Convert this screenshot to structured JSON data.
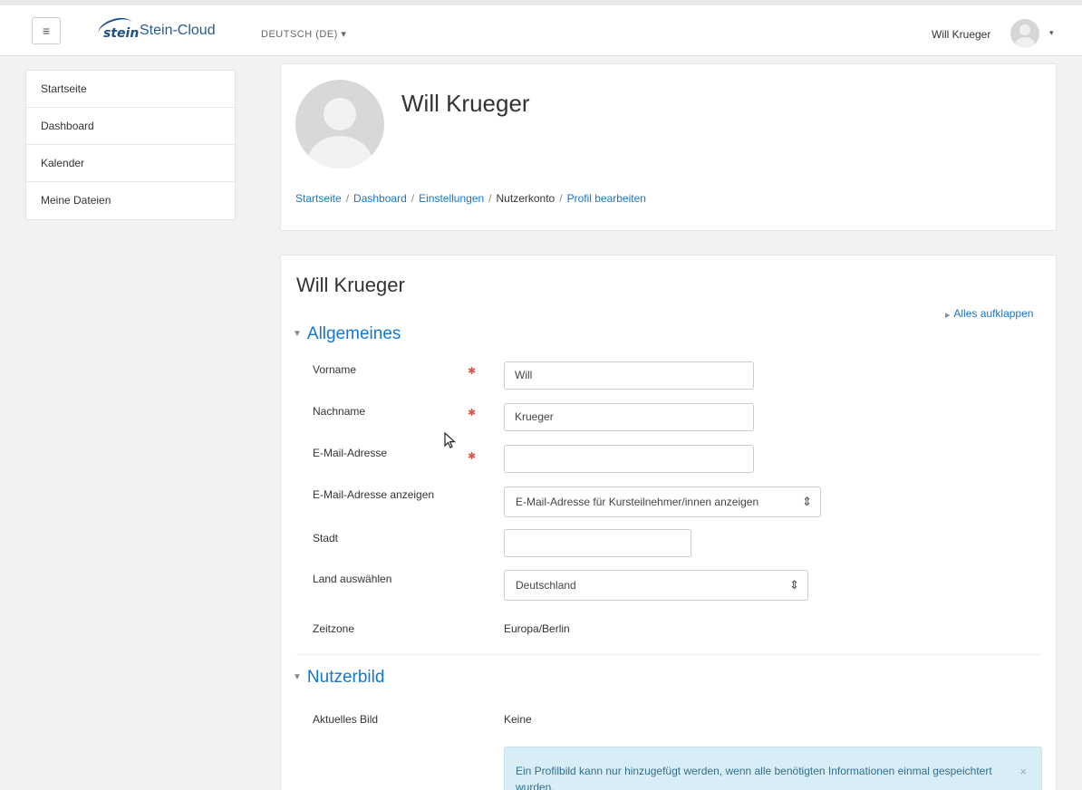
{
  "navbar": {
    "menu_icon": "hamburger-icon",
    "logo_word": "stein",
    "site_title": "Stein-Cloud",
    "language": "DEUTSCH (DE) ▾",
    "user_name": "Will Krueger",
    "user_caret": "▾"
  },
  "sidebar": {
    "items": [
      {
        "label": "Startseite"
      },
      {
        "label": "Dashboard"
      },
      {
        "label": "Kalender"
      },
      {
        "label": "Meine Dateien"
      }
    ]
  },
  "header": {
    "name": "Will Krueger",
    "breadcrumb": [
      {
        "label": "Startseite",
        "link": true
      },
      {
        "label": "Dashboard",
        "link": true
      },
      {
        "label": "Einstellungen",
        "link": true
      },
      {
        "label": "Nutzerkonto",
        "link": false
      },
      {
        "label": "Profil bearbeiten",
        "link": true
      }
    ],
    "separator": "/"
  },
  "form": {
    "title": "Will Krueger",
    "expand_all": "Alles aufklappen",
    "section_general": "Allgemeines",
    "section_picture": "Nutzerbild",
    "required_marker": "✱",
    "fields": {
      "firstname_label": "Vorname",
      "firstname_value": "Will",
      "lastname_label": "Nachname",
      "lastname_value": "Krueger",
      "email_label": "E-Mail-Adresse",
      "email_value": "",
      "maildisplay_label": "E-Mail-Adresse anzeigen",
      "maildisplay_value": "E-Mail-Adresse für Kursteilnehmer/innen anzeigen",
      "city_label": "Stadt",
      "city_value": "",
      "country_label": "Land auswählen",
      "country_value": "Deutschland",
      "timezone_label": "Zeitzone",
      "timezone_value": "Europa/Berlin",
      "current_picture_label": "Aktuelles Bild",
      "current_picture_value": "Keine"
    },
    "alert_text": "Ein Profilbild kann nur hinzugefügt werden, wenn alle benötigten Informationen einmal gespeichtert wurden.",
    "alert_close": "×"
  },
  "colors": {
    "link": "#1177d1",
    "required": "#d9534f",
    "alert_bg": "#d9edf7",
    "page_bg": "#f2f2f2"
  }
}
